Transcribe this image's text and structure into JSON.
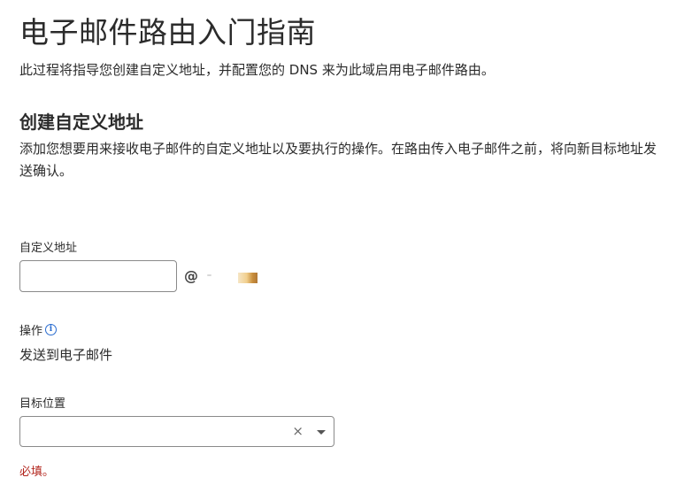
{
  "page": {
    "title": "电子邮件路由入门指南",
    "intro": "此过程将指导您创建自定义地址，并配置您的 DNS 来为此域启用电子邮件路由。"
  },
  "section": {
    "title": "创建自定义地址",
    "description": "添加您想要用来接收电子邮件的自定义地址以及要执行的操作。在路由传入电子邮件之前，将向新目标地址发送确认。"
  },
  "custom_address": {
    "label": "自定义地址",
    "value": "",
    "at_symbol": "@"
  },
  "action": {
    "label": "操作",
    "info_icon": "info-icon",
    "value": "发送到电子邮件"
  },
  "destination": {
    "label": "目标位置",
    "value": "",
    "clear_icon": "×",
    "dropdown_icon": "chevron-down-icon",
    "error": "必填。"
  },
  "colors": {
    "error": "#b3261e",
    "info": "#2a6ccf",
    "border": "#8a8a8a"
  }
}
